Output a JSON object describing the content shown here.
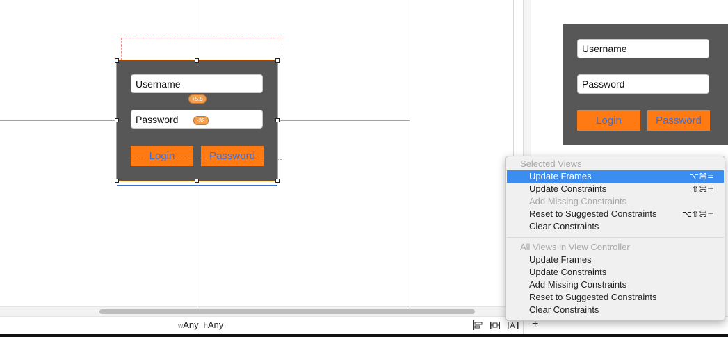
{
  "canvas": {
    "username_placeholder": "Username",
    "password_placeholder": "Password",
    "login_label": "Login",
    "password_button_label": "Password",
    "badge_top": "+5.5",
    "badge_mid": "-32"
  },
  "preview": {
    "username_placeholder": "Username",
    "password_placeholder": "Password",
    "login_label": "Login",
    "password_button_label": "Password"
  },
  "size_class": {
    "w_prefix": "w",
    "w_value": "Any",
    "h_prefix": "h",
    "h_value": "Any"
  },
  "toolbar": {
    "align_icon": "align-icon",
    "pin_icon": "pin-icon",
    "resolve_icon": "resolve-issues-icon",
    "add_label": "+"
  },
  "menu": {
    "section1_title": "Selected Views",
    "section1_items": [
      {
        "label": "Update Frames",
        "shortcut": "⌥⌘=",
        "state": "selected"
      },
      {
        "label": "Update Constraints",
        "shortcut": "⇧⌘=",
        "state": "normal"
      },
      {
        "label": "Add Missing Constraints",
        "shortcut": "",
        "state": "disabled"
      },
      {
        "label": "Reset to Suggested Constraints",
        "shortcut": "⌥⇧⌘=",
        "state": "normal"
      },
      {
        "label": "Clear Constraints",
        "shortcut": "",
        "state": "normal"
      }
    ],
    "section2_title": "All Views in View Controller",
    "section2_items": [
      {
        "label": "Update Frames"
      },
      {
        "label": "Update Constraints"
      },
      {
        "label": "Add Missing Constraints"
      },
      {
        "label": "Reset to Suggested Constraints"
      },
      {
        "label": "Clear Constraints"
      }
    ]
  },
  "colors": {
    "panel": "#575757",
    "accent_orange": "#ff7a12",
    "button_text_blue": "#3b6fd6",
    "guide_orange": "#e0a020",
    "menu_highlight": "#3b8df0"
  }
}
